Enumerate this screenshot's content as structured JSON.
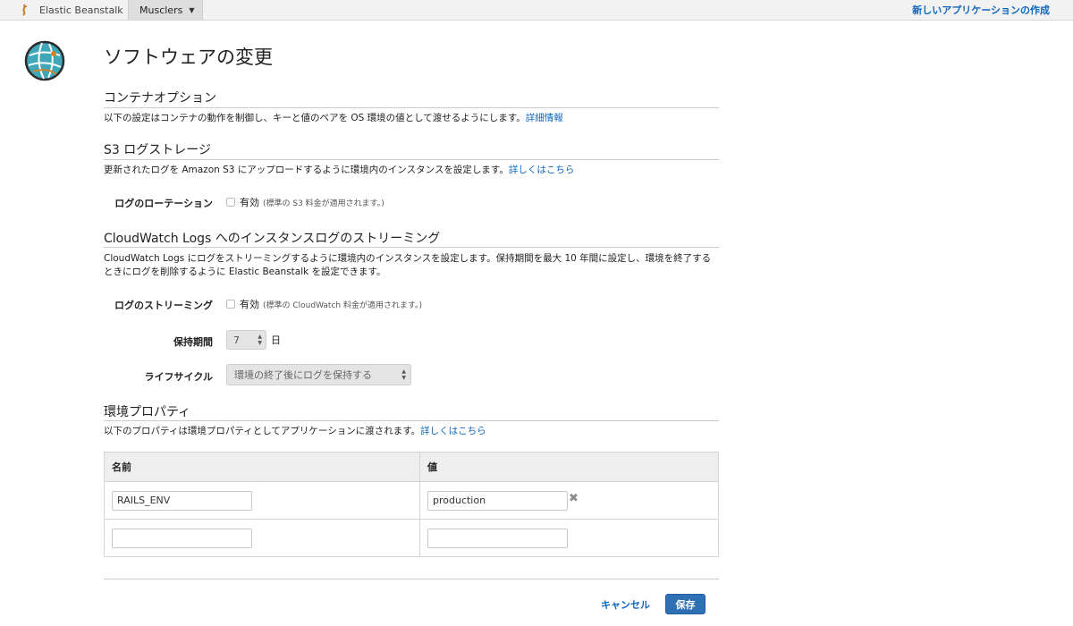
{
  "topbar": {
    "brand": "Elastic Beanstalk",
    "app_menu": "Musclers",
    "new_app_link": "新しいアプリケーションの作成"
  },
  "page": {
    "title": "ソフトウェアの変更"
  },
  "container_options": {
    "heading": "コンテナオプション",
    "description": "以下の設定はコンテナの動作を制御し、キーと値のペアを OS 環境の値として渡せるようにします。",
    "link": "詳細情報"
  },
  "s3_logs": {
    "heading": "S3 ログストレージ",
    "description": "更新されたログを Amazon S3 にアップロードするように環境内のインスタンスを設定します。",
    "link": "詳しくはこちら",
    "rotation_label": "ログのローテーション",
    "enabled_label": "有効",
    "enabled_note": "(標準の S3 料金が適用されます。)",
    "enabled": false
  },
  "cloudwatch": {
    "heading": "CloudWatch Logs へのインスタンスログのストリーミング",
    "description_line1": "CloudWatch Logs にログをストリーミングするように環境内のインスタンスを設定します。保持期間を最大 10 年間に設定し、環境を終了する",
    "description_line2": "ときにログを削除するように Elastic Beanstalk を設定できます。",
    "streaming_label": "ログのストリーミング",
    "enabled_label": "有効",
    "enabled_note": "(標準の CloudWatch 料金が適用されます。)",
    "enabled": false,
    "retention_label": "保持期間",
    "retention_value": "7",
    "retention_unit": "日",
    "lifecycle_label": "ライフサイクル",
    "lifecycle_value": "環境の終了後にログを保持する"
  },
  "env_props": {
    "heading": "環境プロパティ",
    "description": "以下のプロパティは環境プロパティとしてアプリケーションに渡されます。",
    "link": "詳しくはこちら",
    "col_name": "名前",
    "col_value": "値",
    "rows": [
      {
        "name": "RAILS_ENV",
        "value": "production"
      },
      {
        "name": "",
        "value": ""
      }
    ]
  },
  "actions": {
    "cancel": "キャンセル",
    "save": "保存"
  },
  "colors": {
    "link": "#1166bb",
    "primary_button": "#2f6fb4"
  }
}
